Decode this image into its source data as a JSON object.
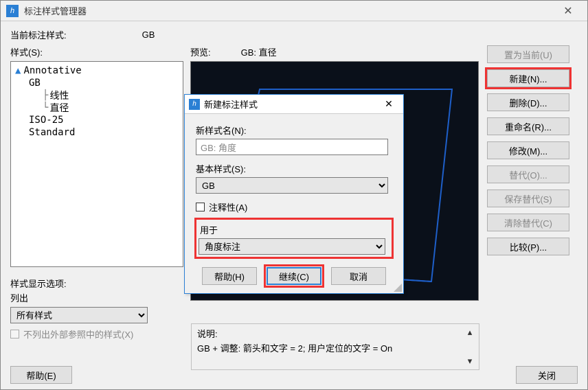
{
  "window": {
    "title": "标注样式管理器",
    "close_glyph": "✕"
  },
  "current_style": {
    "label": "当前标注样式:",
    "value": "GB"
  },
  "styles_label": "样式(S):",
  "tree": {
    "annotative": "Annotative",
    "gb": "GB",
    "linear": "线性",
    "diameter": "直径",
    "iso25": "ISO-25",
    "standard": "Standard"
  },
  "preview": {
    "label": "预览:",
    "value": "GB: 直径"
  },
  "buttons": {
    "set_current": "置为当前(U)",
    "new": "新建(N)...",
    "delete": "删除(D)...",
    "rename": "重命名(R)...",
    "modify": "修改(M)...",
    "override": "替代(O)...",
    "save_override": "保存替代(S)",
    "clear_override": "清除替代(C)",
    "compare": "比较(P)..."
  },
  "display_options": {
    "label": "样式显示选项:",
    "list_label": "列出",
    "combo": "所有样式",
    "checkbox": "不列出外部参照中的样式(X)"
  },
  "description": {
    "label": "说明:",
    "text": "GB + 调整: 箭头和文字 = 2; 用户定位的文字 = On"
  },
  "help_btn": "帮助(E)",
  "close_btn": "关闭",
  "dialog": {
    "title": "新建标注样式",
    "new_name_label": "新样式名(N):",
    "new_name_value": "GB: 角度",
    "base_style_label": "基本样式(S):",
    "base_style_value": "GB",
    "annotative_label": "注释性(A)",
    "used_for_label": "用于",
    "used_for_value": "角度标注",
    "help": "帮助(H)",
    "continue": "继续(C)",
    "cancel": "取消"
  }
}
